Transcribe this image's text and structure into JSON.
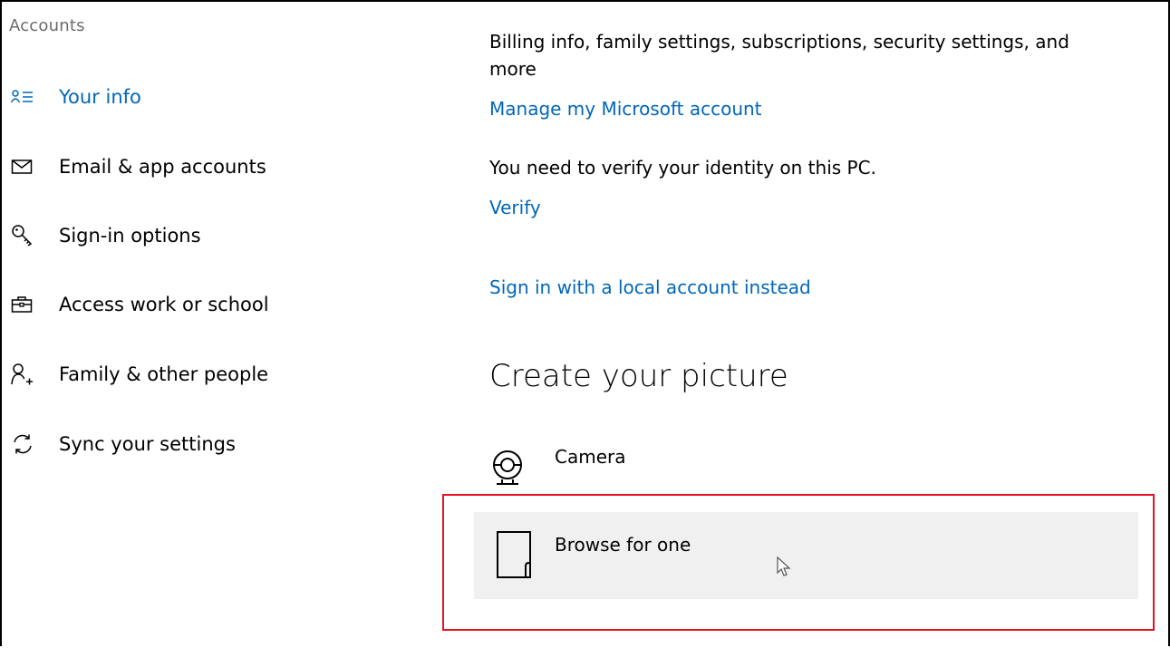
{
  "sidebar": {
    "title": "Accounts",
    "items": [
      {
        "label": "Your info",
        "icon": "your-info-icon",
        "active": true
      },
      {
        "label": "Email & app accounts",
        "icon": "envelope-icon",
        "active": false
      },
      {
        "label": "Sign-in options",
        "icon": "key-icon",
        "active": false
      },
      {
        "label": "Access work or school",
        "icon": "briefcase-icon",
        "active": false
      },
      {
        "label": "Family & other people",
        "icon": "add-person-icon",
        "active": false
      },
      {
        "label": "Sync your settings",
        "icon": "sync-icon",
        "active": false
      }
    ]
  },
  "main": {
    "billing_text_line1": "Billing info, family settings, subscriptions, security settings, and",
    "billing_text_line2": "more",
    "manage_link": "Manage my Microsoft account",
    "verify_text": "You need to verify your identity on this PC.",
    "verify_link": "Verify",
    "local_account_link": "Sign in with a local account instead",
    "create_picture_heading": "Create your picture",
    "options": [
      {
        "label": "Camera",
        "icon": "camera-icon"
      },
      {
        "label": "Browse for one",
        "icon": "file-browse-icon"
      }
    ]
  },
  "colors": {
    "accent": "#0067b8",
    "highlight_box": "#e81123",
    "hover_background": "#f0f0f0",
    "secondary_text": "#6b6b6b"
  }
}
